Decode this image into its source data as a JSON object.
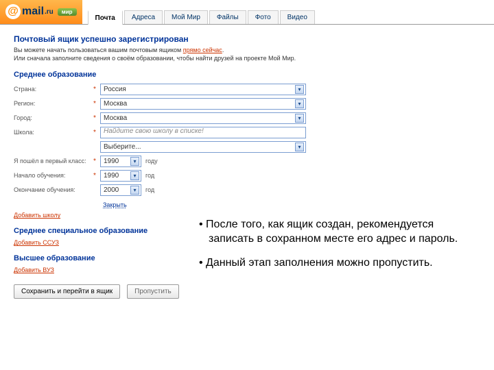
{
  "header": {
    "logo_main": "mail",
    "logo_tld": ".ru",
    "logo_at": "@",
    "badge": "мир"
  },
  "tabs": [
    "Почта",
    "Адреса",
    "Мой Мир",
    "Файлы",
    "Фото",
    "Видео"
  ],
  "title": "Почтовый ящик успешно зарегистрирован",
  "sub1": "Вы можете начать пользоваться вашим почтовым ящиком ",
  "sub1_link": "прямо сейчас",
  "sub1_end": ".",
  "sub2": "Или сначала заполните сведения о своём образовании, чтобы найти друзей на проекте Мой Мир.",
  "sec_mid": "Среднее образование",
  "fields": {
    "country": "Страна:",
    "region": "Регион:",
    "city": "Город:",
    "school": "Школа:",
    "first_class": "Я пошёл в первый класс:",
    "start": "Начало обучения:",
    "end": "Окончание обучения:"
  },
  "values": {
    "country": "Россия",
    "region": "Москва",
    "city": "Москва",
    "school_placeholder": "Найдите свою школу в списке!",
    "school_value": "Выберите...",
    "first_class_year": "1990",
    "start_year": "1990",
    "end_year": "2000",
    "year_suffix": "год",
    "year_suffix2": "году"
  },
  "hide": "Закрыть",
  "add_school": "Добавить школу",
  "sec_spec": "Среднее специальное образование",
  "add_suz": "Добавить ССУЗ",
  "sec_high": "Высшее образование",
  "add_vuz": "Добавить ВУЗ",
  "btn_save": "Сохранить и перейти в ящик",
  "btn_skip": "Пропустить",
  "overlay": {
    "p1": "• После того, как ящик создан, рекомендуется записать в сохранном месте  его адрес и пароль.",
    "p2": "• Данный этап заполнения можно пропустить."
  }
}
